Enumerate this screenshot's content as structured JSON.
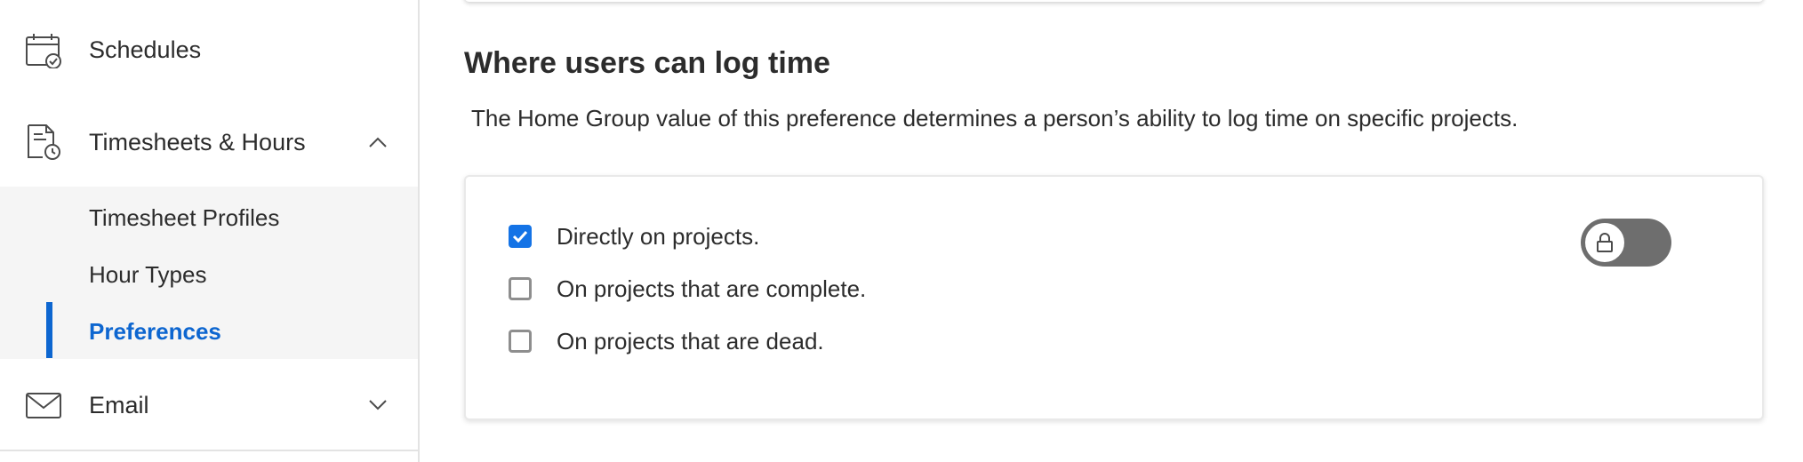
{
  "sidebar": {
    "items": [
      {
        "label": "Schedules",
        "icon": "calendar-check-icon"
      },
      {
        "label": "Timesheets & Hours",
        "icon": "timesheet-clock-icon",
        "expanded": true,
        "children": [
          "Timesheet Profiles",
          "Hour Types",
          "Preferences"
        ]
      },
      {
        "label": "Email",
        "icon": "envelope-icon",
        "expanded": false
      }
    ],
    "active_item": "Preferences"
  },
  "section": {
    "title": "Where users can log time",
    "description": "The Home Group value of this preference determines a person’s ability to log time on specific projects.",
    "options": [
      {
        "label": "Directly on projects.",
        "checked": true
      },
      {
        "label": "On projects that are complete.",
        "checked": false
      },
      {
        "label": "On projects that are dead.",
        "checked": false
      }
    ],
    "lock_toggle": {
      "icon": "lock-icon",
      "on": false
    }
  },
  "colors": {
    "accent": "#0d66d0",
    "checkbox_checked": "#1473e6",
    "toggle_track": "#6e6e6e",
    "subnav_bg": "#f5f5f5"
  }
}
